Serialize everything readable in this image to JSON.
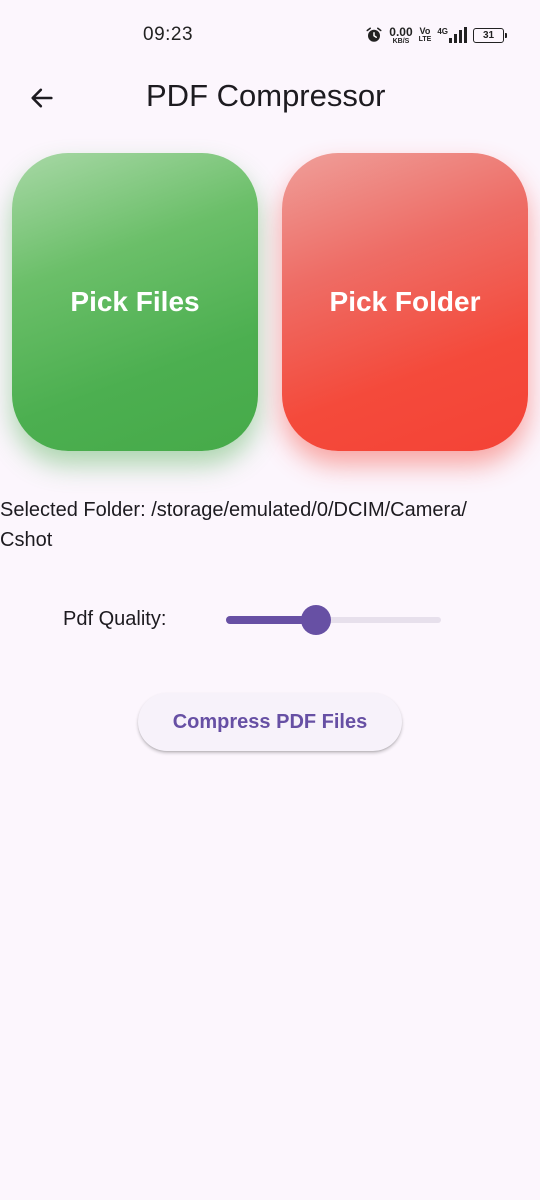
{
  "status_bar": {
    "time": "09:23",
    "speed_value": "0.00",
    "speed_unit": "KB/S",
    "volte_top": "Vo",
    "volte_bottom": "LTE",
    "network": "4G",
    "battery": "31"
  },
  "app_bar": {
    "back_icon": "arrow-back-icon",
    "title": "PDF Compressor"
  },
  "pick_files": {
    "label": "Pick Files",
    "color": "#4caf50"
  },
  "pick_folder": {
    "label": "Pick Folder",
    "color": "#f44336"
  },
  "selected_folder_text": "Selected Folder: /storage/emulated/0/DCIM/Camera/\nCshot",
  "quality": {
    "label": "Pdf Quality:",
    "value": 0.42,
    "accent": "#6750a4"
  },
  "compress_button": {
    "label": "Compress PDF Files"
  }
}
